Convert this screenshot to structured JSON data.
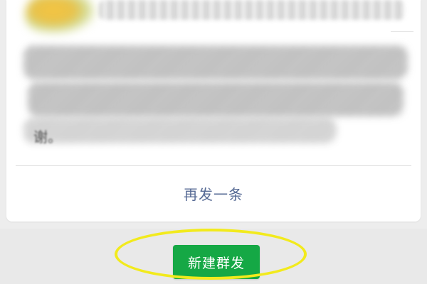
{
  "message_card": {
    "resend_label": "再发一条",
    "trailing_text": "谢。"
  },
  "footer": {
    "new_button_label": "新建群发"
  },
  "colors": {
    "link_blue": "#576b95",
    "button_green": "#15a845",
    "highlight_yellow": "#f2ea1d",
    "background_gray": "#ededed"
  }
}
